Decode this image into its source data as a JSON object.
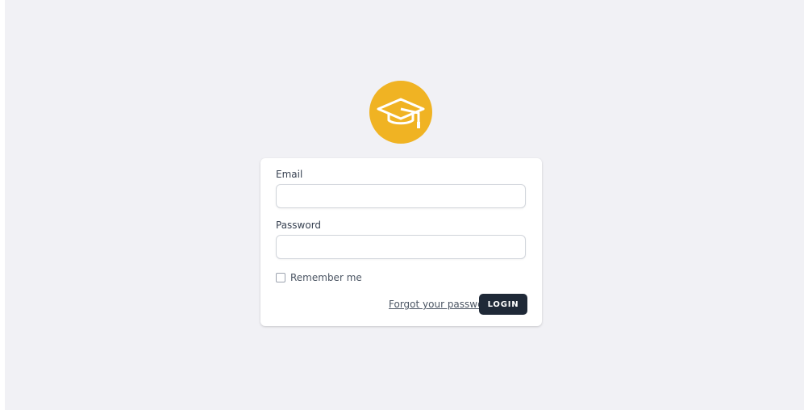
{
  "logo": {
    "icon": "graduation-cap-icon",
    "color": "#f0b323"
  },
  "form": {
    "email_label": "Email",
    "email_value": "",
    "password_label": "Password",
    "password_value": "",
    "remember_label": "Remember me",
    "remember_checked": false,
    "forgot_link": "Forgot your password?",
    "login_button": "LOGIN"
  },
  "colors": {
    "background": "#f1f1f5",
    "button": "#1f2937"
  }
}
